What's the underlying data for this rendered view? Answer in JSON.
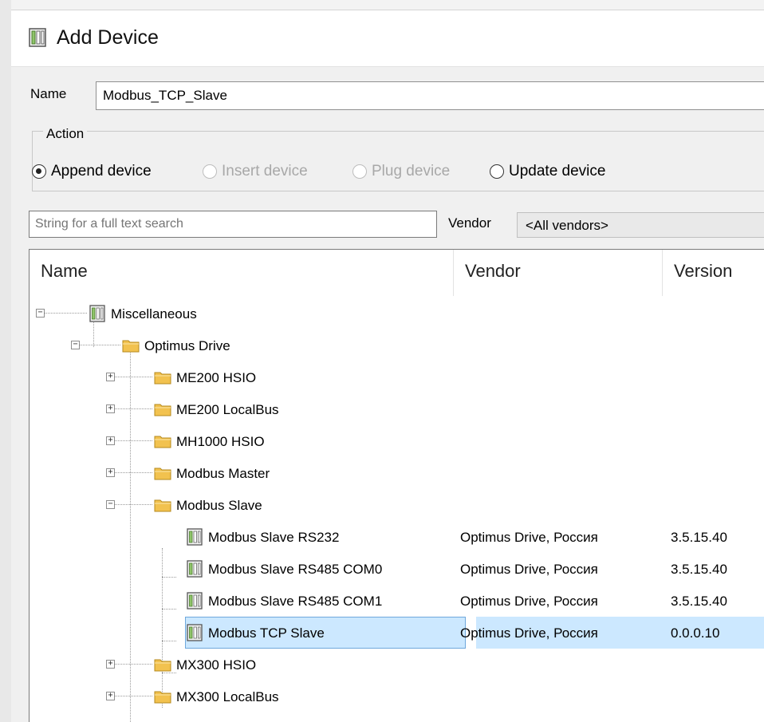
{
  "window": {
    "title": "Add Device",
    "icon": "device-icon"
  },
  "name_field": {
    "label": "Name",
    "value": "Modbus_TCP_Slave"
  },
  "action": {
    "legend": "Action",
    "options": [
      {
        "label": "Append device",
        "checked": true,
        "enabled": true
      },
      {
        "label": "Insert device",
        "checked": false,
        "enabled": false
      },
      {
        "label": "Plug device",
        "checked": false,
        "enabled": false
      },
      {
        "label": "Update device",
        "checked": false,
        "enabled": true
      }
    ]
  },
  "search": {
    "placeholder": "String for a full text search"
  },
  "vendor_filter": {
    "label": "Vendor",
    "selected": "<All vendors>"
  },
  "tree": {
    "columns": [
      "Name",
      "Vendor",
      "Version"
    ],
    "rows": [
      {
        "label": "Miscellaneous",
        "vendor": "",
        "version": "",
        "icon": "device-icon",
        "expander": "minus"
      },
      {
        "label": "Optimus Drive",
        "vendor": "",
        "version": "",
        "icon": "folder-icon",
        "expander": "minus"
      },
      {
        "label": "ME200 HSIO",
        "vendor": "",
        "version": "",
        "icon": "folder-icon",
        "expander": "plus"
      },
      {
        "label": "ME200 LocalBus",
        "vendor": "",
        "version": "",
        "icon": "folder-icon",
        "expander": "plus"
      },
      {
        "label": "MH1000 HSIO",
        "vendor": "",
        "version": "",
        "icon": "folder-icon",
        "expander": "plus"
      },
      {
        "label": "Modbus Master",
        "vendor": "",
        "version": "",
        "icon": "folder-icon",
        "expander": "plus"
      },
      {
        "label": "Modbus Slave",
        "vendor": "",
        "version": "",
        "icon": "folder-icon",
        "expander": "minus"
      },
      {
        "label": "Modbus Slave RS232",
        "vendor": "Optimus Drive, Россия",
        "version": "3.5.15.40",
        "icon": "device-icon",
        "expander": ""
      },
      {
        "label": "Modbus Slave RS485 COM0",
        "vendor": "Optimus Drive, Россия",
        "version": "3.5.15.40",
        "icon": "device-icon",
        "expander": ""
      },
      {
        "label": "Modbus Slave RS485 COM1",
        "vendor": "Optimus Drive, Россия",
        "version": "3.5.15.40",
        "icon": "device-icon",
        "expander": ""
      },
      {
        "label": "Modbus TCP Slave",
        "vendor": "Optimus Drive, Россия",
        "version": "0.0.0.10",
        "icon": "device-icon",
        "expander": "",
        "selected": true
      },
      {
        "label": "MX300 HSIO",
        "vendor": "",
        "version": "",
        "icon": "folder-icon",
        "expander": "plus"
      },
      {
        "label": "MX300 LocalBus",
        "vendor": "",
        "version": "",
        "icon": "folder-icon",
        "expander": "plus"
      }
    ]
  },
  "colors": {
    "selection": "#cce8ff",
    "selection_border": "#6fa8dc",
    "folder": "#f2c24f"
  }
}
